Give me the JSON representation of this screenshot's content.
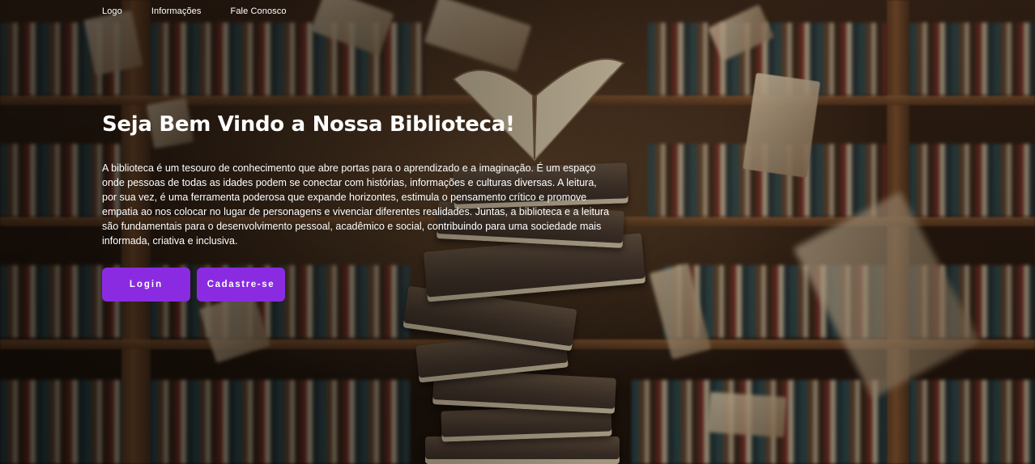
{
  "nav": {
    "items": [
      {
        "label": "Logo"
      },
      {
        "label": "Informações"
      },
      {
        "label": "Fale Conosco"
      }
    ]
  },
  "hero": {
    "title": "Seja Bem Vindo a Nossa Biblioteca!",
    "description": "A biblioteca é um tesouro de conhecimento que abre portas para o aprendizado e a imaginação. É um espaço onde pessoas de todas as idades podem se conectar com histórias, informações e culturas diversas. A leitura, por sua vez, é uma ferramenta poderosa que expande horizontes, estimula o pensamento crítico e promove empatia ao nos colocar no lugar de personagens e vivenciar diferentes realidades. Juntas, a biblioteca e a leitura são fundamentais para o desenvolvimento pessoal, acadêmico e social, contribuindo para uma sociedade mais informada, criativa e inclusiva.",
    "buttons": {
      "login": "Login",
      "signup": "Cadastre-se"
    }
  },
  "colors": {
    "button_bg": "#8a2be2",
    "text": "#ffffff"
  }
}
